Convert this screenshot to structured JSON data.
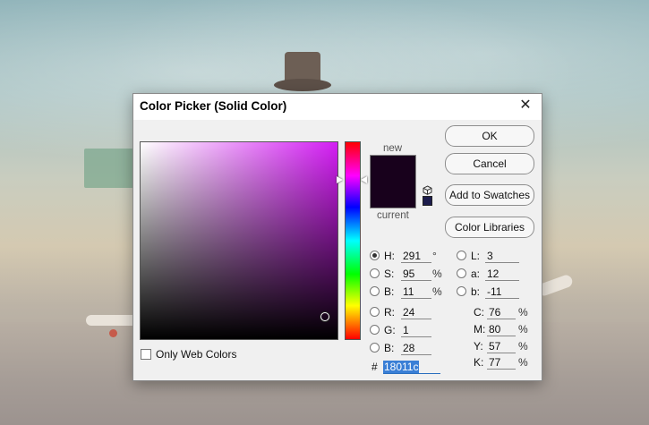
{
  "dialog": {
    "title": "Color Picker (Solid Color)",
    "close_glyph": "✕"
  },
  "preview": {
    "new_label": "new",
    "current_label": "current",
    "new_color": "#18011c",
    "current_color": "#18011c",
    "websafe_icon": "cube-icon"
  },
  "buttons": {
    "ok": "OK",
    "cancel": "Cancel",
    "add_swatches": "Add to Swatches",
    "color_libraries": "Color Libraries"
  },
  "hsb": {
    "h": {
      "label": "H:",
      "value": "291",
      "unit": "°"
    },
    "s": {
      "label": "S:",
      "value": "95",
      "unit": "%"
    },
    "b": {
      "label": "B:",
      "value": "11",
      "unit": "%"
    }
  },
  "rgb": {
    "r": {
      "label": "R:",
      "value": "24"
    },
    "g": {
      "label": "G:",
      "value": "1"
    },
    "b": {
      "label": "B:",
      "value": "28"
    }
  },
  "lab": {
    "l": {
      "label": "L:",
      "value": "3"
    },
    "a": {
      "label": "a:",
      "value": "12"
    },
    "b": {
      "label": "b:",
      "value": "-11"
    }
  },
  "cmyk": {
    "c": {
      "label": "C:",
      "value": "76",
      "unit": "%"
    },
    "m": {
      "label": "M:",
      "value": "80",
      "unit": "%"
    },
    "y": {
      "label": "Y:",
      "value": "57",
      "unit": "%"
    },
    "k": {
      "label": "K:",
      "value": "77",
      "unit": "%"
    }
  },
  "hex": {
    "label": "#",
    "value": "18011c"
  },
  "web_colors": {
    "label": "Only Web Colors",
    "checked": false
  },
  "selected_mode": "H"
}
